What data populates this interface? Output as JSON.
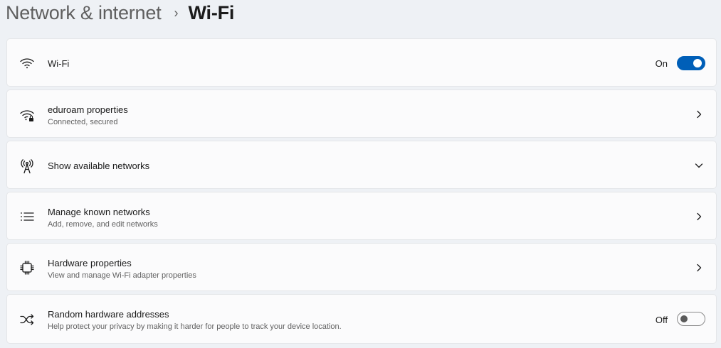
{
  "breadcrumb": {
    "parent": "Network & internet",
    "separator": "›",
    "current": "Wi-Fi"
  },
  "rows": {
    "wifi": {
      "title": "Wi-Fi",
      "toggle_label": "On",
      "toggle_state": "on",
      "icon": "wifi-icon"
    },
    "eduroam": {
      "title": "eduroam properties",
      "subtitle": "Connected, secured",
      "icon": "wifi-secured-icon"
    },
    "available": {
      "title": "Show available networks",
      "icon": "antenna-icon"
    },
    "known": {
      "title": "Manage known networks",
      "subtitle": "Add, remove, and edit networks",
      "icon": "list-icon"
    },
    "hardware": {
      "title": "Hardware properties",
      "subtitle": "View and manage Wi-Fi adapter properties",
      "icon": "chip-icon"
    },
    "random": {
      "title": "Random hardware addresses",
      "subtitle": "Help protect your privacy by making it harder for people to track your device location.",
      "toggle_label": "Off",
      "toggle_state": "off",
      "icon": "shuffle-icon"
    }
  },
  "colors": {
    "accent": "#005fb8",
    "card_background": "#fbfbfc",
    "page_background": "#eef1f5"
  }
}
